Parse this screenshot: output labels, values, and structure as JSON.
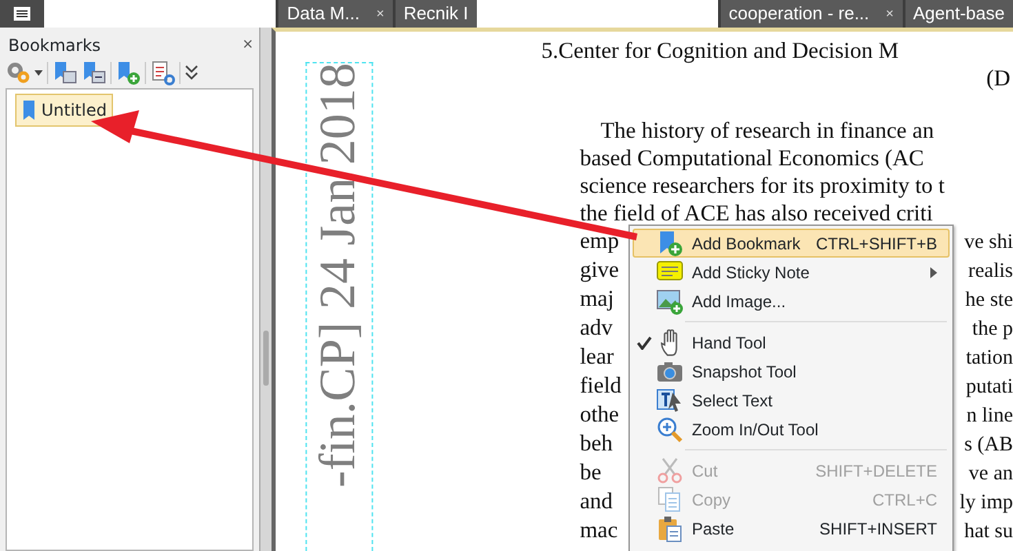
{
  "tab_bar": {
    "tabs": [
      {
        "label": "Data M...",
        "close": "×"
      },
      {
        "label": "Recnik I"
      },
      {
        "label": "cooperation - re...",
        "close": "×"
      },
      {
        "label": "Agent-base"
      }
    ]
  },
  "bookmarks_panel": {
    "title": "Bookmarks",
    "close": "×",
    "items": [
      {
        "label": "Untitled",
        "selected": true
      }
    ]
  },
  "document": {
    "arxiv_stamp": "-fin.CP]  24 Jan 2018",
    "heading": "5.Center for Cognition and Decision M",
    "heading_2": "(D",
    "lines": [
      {
        "left": "The history of research in finance an"
      },
      {
        "left": "based Computational Economics (AC"
      },
      {
        "left": "science researchers for its proximity to t"
      },
      {
        "left": "the field of ACE has also received criti"
      },
      {
        "left": "emp",
        "right": "ve shi"
      },
      {
        "left": "give",
        "right": "realis"
      },
      {
        "left": "maj",
        "right": "he ste"
      },
      {
        "left": "adv",
        "right": "the p"
      },
      {
        "left": "lear",
        "right": "tation"
      },
      {
        "left": "field",
        "right": "putati"
      },
      {
        "left": "othe",
        "right": "n line"
      },
      {
        "left": "beh",
        "right": "s (AB"
      },
      {
        "left": "be",
        "right": "ve an"
      },
      {
        "left": "and",
        "right": "ly imp"
      },
      {
        "left": "mac",
        "right": "hat su"
      }
    ]
  },
  "context_menu": {
    "items": [
      {
        "kind": "item",
        "label": "Add Bookmark",
        "shortcut": "CTRL+SHIFT+B",
        "highlighted": true,
        "checked": false,
        "disabled": false,
        "submenu": false
      },
      {
        "kind": "item",
        "label": "Add Sticky Note",
        "highlighted": false,
        "checked": false,
        "disabled": false,
        "submenu": true
      },
      {
        "kind": "item",
        "label": "Add Image...",
        "highlighted": false,
        "checked": false,
        "disabled": false,
        "submenu": false
      },
      {
        "kind": "separator"
      },
      {
        "kind": "item",
        "label": "Hand Tool",
        "highlighted": false,
        "checked": true,
        "disabled": false,
        "submenu": false
      },
      {
        "kind": "item",
        "label": "Snapshot Tool",
        "highlighted": false,
        "checked": false,
        "disabled": false,
        "submenu": false
      },
      {
        "kind": "item",
        "label": "Select Text",
        "highlighted": false,
        "checked": false,
        "disabled": false,
        "submenu": false
      },
      {
        "kind": "item",
        "label": "Zoom In/Out Tool",
        "highlighted": false,
        "checked": false,
        "disabled": false,
        "submenu": false
      },
      {
        "kind": "separator"
      },
      {
        "kind": "item",
        "label": "Cut",
        "shortcut": "SHIFT+DELETE",
        "highlighted": false,
        "checked": false,
        "disabled": true,
        "submenu": false
      },
      {
        "kind": "item",
        "label": "Copy",
        "shortcut": "CTRL+C",
        "highlighted": false,
        "checked": false,
        "disabled": true,
        "submenu": false
      },
      {
        "kind": "item",
        "label": "Paste",
        "shortcut": "SHIFT+INSERT",
        "highlighted": false,
        "checked": false,
        "disabled": false,
        "submenu": false
      }
    ]
  }
}
